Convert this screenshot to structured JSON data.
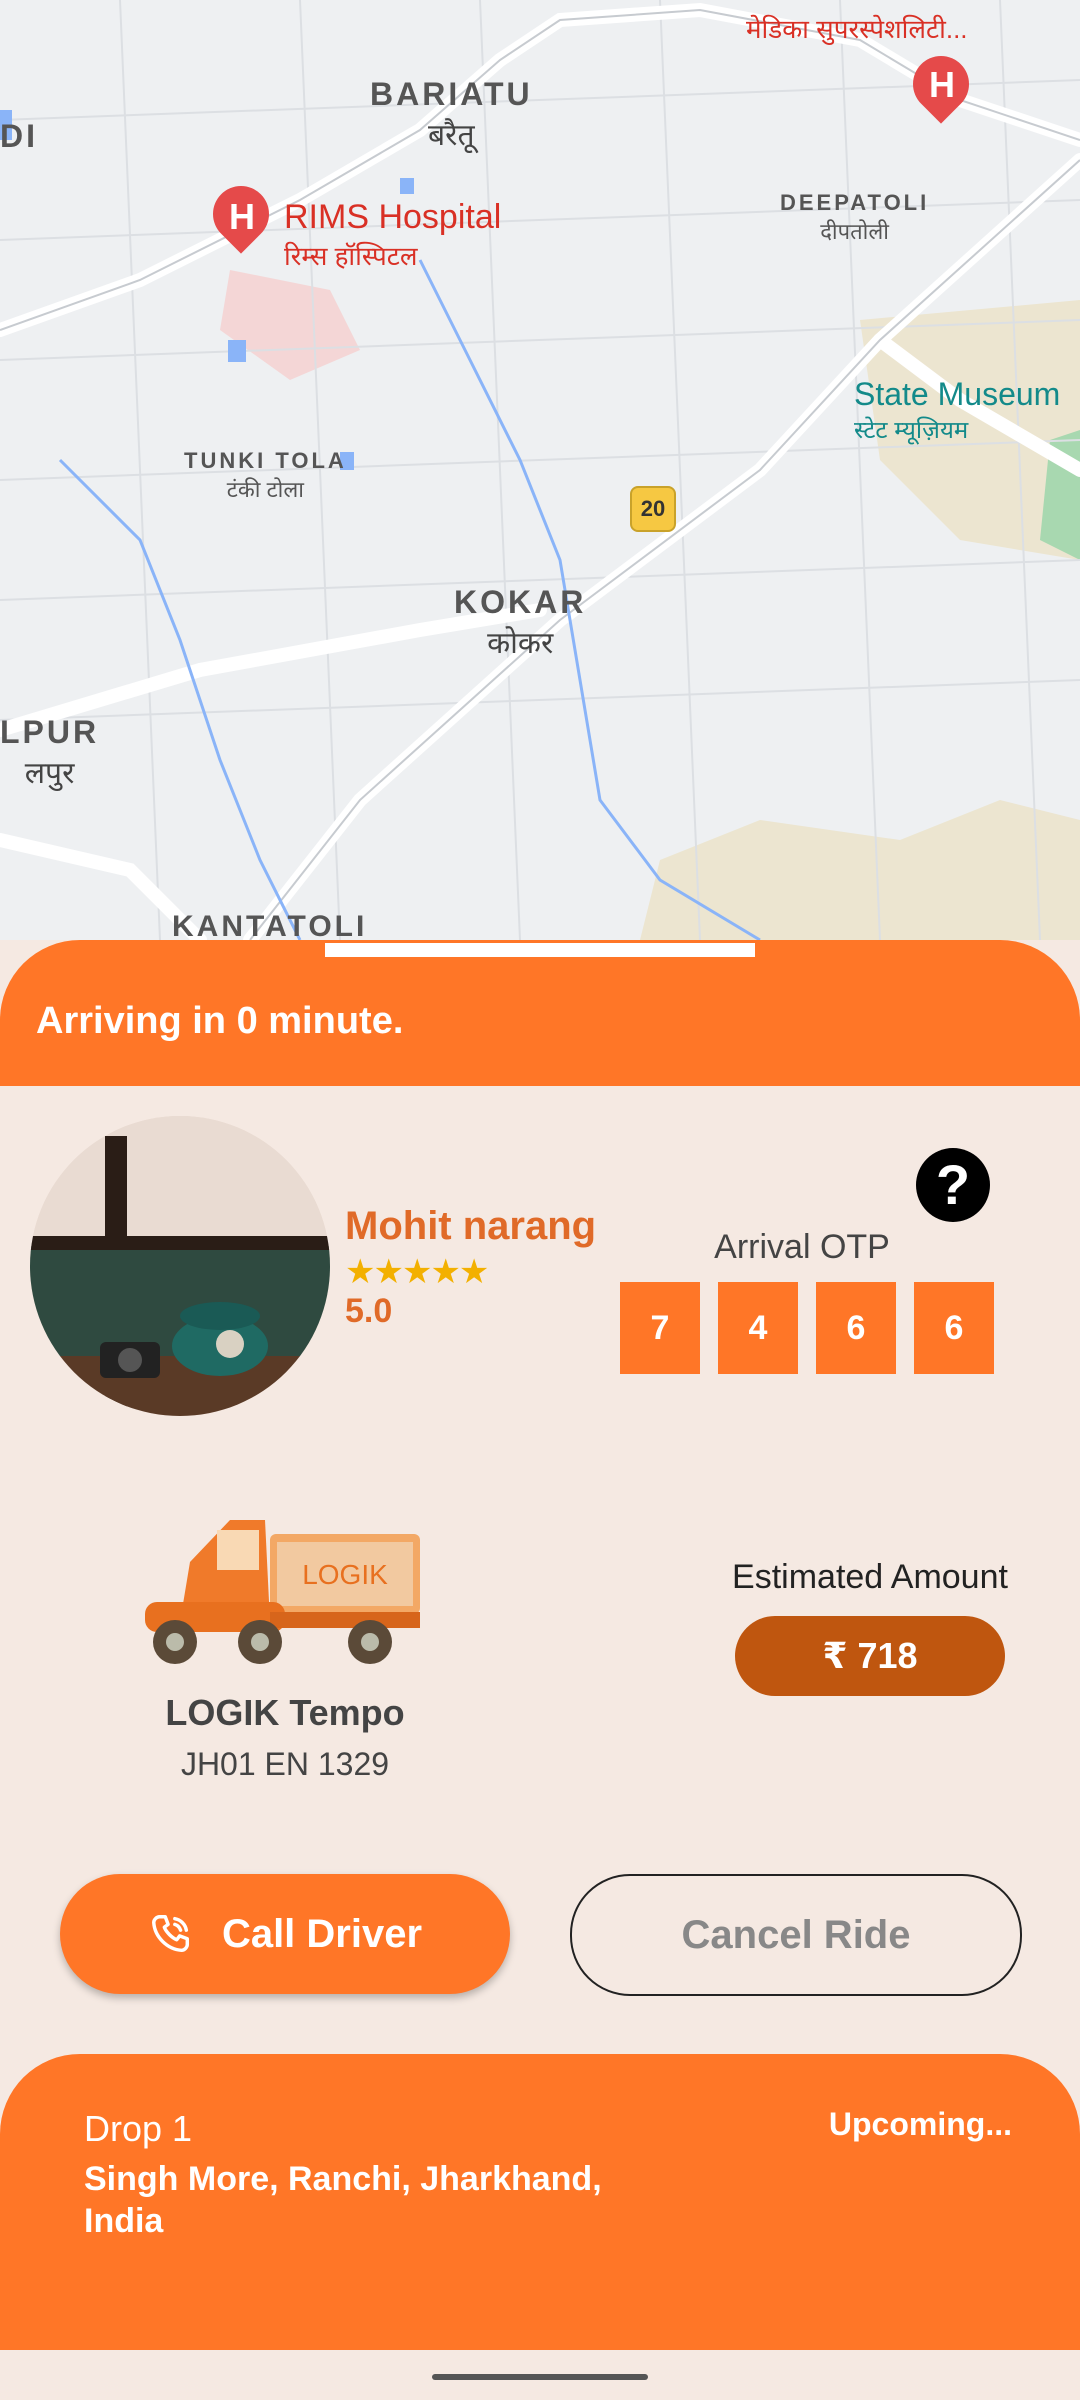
{
  "map": {
    "labels": {
      "bariatu": "BARIATU",
      "bariatu_hi": "बरैतू",
      "di": "DI",
      "rims": "RIMS Hospital",
      "rims_hi": "रिम्स हॉस्पिटल",
      "medica_hi": "मेडिका सुपरस्पेशलिटी...",
      "deepatoli": "DEEPATOLI",
      "deepatoli_hi": "दीपतोली",
      "state_museum": "State Museum",
      "state_museum_hi": "स्टेट म्यूज़ियम",
      "tunki_tola": "TUNKI TOLA",
      "tunki_tola_hi": "टंकी टोला",
      "route_20": "20",
      "kokar": "KOKAR",
      "kokar_hi": "कोकर",
      "lpur": "LPUR",
      "lpur_hi": "लपुर",
      "kantatoli": "KANTATOLI"
    }
  },
  "status": {
    "text": "Arriving in 0 minute."
  },
  "driver": {
    "name": "Mohit narang",
    "stars": "★★★★★",
    "rating": "5.0"
  },
  "otp": {
    "label": "Arrival OTP",
    "digits": [
      "7",
      "4",
      "6",
      "6"
    ]
  },
  "help_icon": "?",
  "vehicle": {
    "brand_text": "LOGIK",
    "name": "LOGIK Tempo",
    "plate": "JH01 EN 1329"
  },
  "estimate": {
    "label": "Estimated Amount",
    "amount": "₹ 718"
  },
  "actions": {
    "call_label": "Call Driver",
    "cancel_label": "Cancel Ride"
  },
  "drop": {
    "title": "Drop 1",
    "status": "Upcoming...",
    "address": "Singh More, Ranchi, Jharkhand, India"
  },
  "colors": {
    "accent": "#ff7627",
    "amount_pill": "#bf560f",
    "sheet_bg": "#f5e9e2"
  }
}
